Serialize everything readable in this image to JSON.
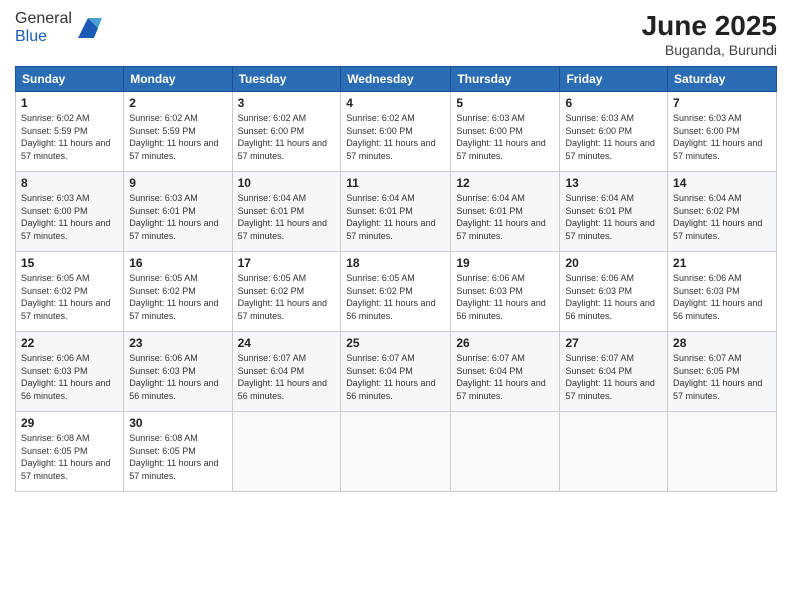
{
  "header": {
    "logo_general": "General",
    "logo_blue": "Blue",
    "month_year": "June 2025",
    "location": "Buganda, Burundi"
  },
  "weekdays": [
    "Sunday",
    "Monday",
    "Tuesday",
    "Wednesday",
    "Thursday",
    "Friday",
    "Saturday"
  ],
  "weeks": [
    [
      {
        "day": "1",
        "sunrise": "6:02 AM",
        "sunset": "5:59 PM",
        "daylight": "11 hours and 57 minutes."
      },
      {
        "day": "2",
        "sunrise": "6:02 AM",
        "sunset": "5:59 PM",
        "daylight": "11 hours and 57 minutes."
      },
      {
        "day": "3",
        "sunrise": "6:02 AM",
        "sunset": "6:00 PM",
        "daylight": "11 hours and 57 minutes."
      },
      {
        "day": "4",
        "sunrise": "6:02 AM",
        "sunset": "6:00 PM",
        "daylight": "11 hours and 57 minutes."
      },
      {
        "day": "5",
        "sunrise": "6:03 AM",
        "sunset": "6:00 PM",
        "daylight": "11 hours and 57 minutes."
      },
      {
        "day": "6",
        "sunrise": "6:03 AM",
        "sunset": "6:00 PM",
        "daylight": "11 hours and 57 minutes."
      },
      {
        "day": "7",
        "sunrise": "6:03 AM",
        "sunset": "6:00 PM",
        "daylight": "11 hours and 57 minutes."
      }
    ],
    [
      {
        "day": "8",
        "sunrise": "6:03 AM",
        "sunset": "6:00 PM",
        "daylight": "11 hours and 57 minutes."
      },
      {
        "day": "9",
        "sunrise": "6:03 AM",
        "sunset": "6:01 PM",
        "daylight": "11 hours and 57 minutes."
      },
      {
        "day": "10",
        "sunrise": "6:04 AM",
        "sunset": "6:01 PM",
        "daylight": "11 hours and 57 minutes."
      },
      {
        "day": "11",
        "sunrise": "6:04 AM",
        "sunset": "6:01 PM",
        "daylight": "11 hours and 57 minutes."
      },
      {
        "day": "12",
        "sunrise": "6:04 AM",
        "sunset": "6:01 PM",
        "daylight": "11 hours and 57 minutes."
      },
      {
        "day": "13",
        "sunrise": "6:04 AM",
        "sunset": "6:01 PM",
        "daylight": "11 hours and 57 minutes."
      },
      {
        "day": "14",
        "sunrise": "6:04 AM",
        "sunset": "6:02 PM",
        "daylight": "11 hours and 57 minutes."
      }
    ],
    [
      {
        "day": "15",
        "sunrise": "6:05 AM",
        "sunset": "6:02 PM",
        "daylight": "11 hours and 57 minutes."
      },
      {
        "day": "16",
        "sunrise": "6:05 AM",
        "sunset": "6:02 PM",
        "daylight": "11 hours and 57 minutes."
      },
      {
        "day": "17",
        "sunrise": "6:05 AM",
        "sunset": "6:02 PM",
        "daylight": "11 hours and 57 minutes."
      },
      {
        "day": "18",
        "sunrise": "6:05 AM",
        "sunset": "6:02 PM",
        "daylight": "11 hours and 56 minutes."
      },
      {
        "day": "19",
        "sunrise": "6:06 AM",
        "sunset": "6:03 PM",
        "daylight": "11 hours and 56 minutes."
      },
      {
        "day": "20",
        "sunrise": "6:06 AM",
        "sunset": "6:03 PM",
        "daylight": "11 hours and 56 minutes."
      },
      {
        "day": "21",
        "sunrise": "6:06 AM",
        "sunset": "6:03 PM",
        "daylight": "11 hours and 56 minutes."
      }
    ],
    [
      {
        "day": "22",
        "sunrise": "6:06 AM",
        "sunset": "6:03 PM",
        "daylight": "11 hours and 56 minutes."
      },
      {
        "day": "23",
        "sunrise": "6:06 AM",
        "sunset": "6:03 PM",
        "daylight": "11 hours and 56 minutes."
      },
      {
        "day": "24",
        "sunrise": "6:07 AM",
        "sunset": "6:04 PM",
        "daylight": "11 hours and 56 minutes."
      },
      {
        "day": "25",
        "sunrise": "6:07 AM",
        "sunset": "6:04 PM",
        "daylight": "11 hours and 56 minutes."
      },
      {
        "day": "26",
        "sunrise": "6:07 AM",
        "sunset": "6:04 PM",
        "daylight": "11 hours and 57 minutes."
      },
      {
        "day": "27",
        "sunrise": "6:07 AM",
        "sunset": "6:04 PM",
        "daylight": "11 hours and 57 minutes."
      },
      {
        "day": "28",
        "sunrise": "6:07 AM",
        "sunset": "6:05 PM",
        "daylight": "11 hours and 57 minutes."
      }
    ],
    [
      {
        "day": "29",
        "sunrise": "6:08 AM",
        "sunset": "6:05 PM",
        "daylight": "11 hours and 57 minutes."
      },
      {
        "day": "30",
        "sunrise": "6:08 AM",
        "sunset": "6:05 PM",
        "daylight": "11 hours and 57 minutes."
      },
      null,
      null,
      null,
      null,
      null
    ]
  ],
  "labels": {
    "sunrise": "Sunrise:",
    "sunset": "Sunset:",
    "daylight": "Daylight:"
  }
}
